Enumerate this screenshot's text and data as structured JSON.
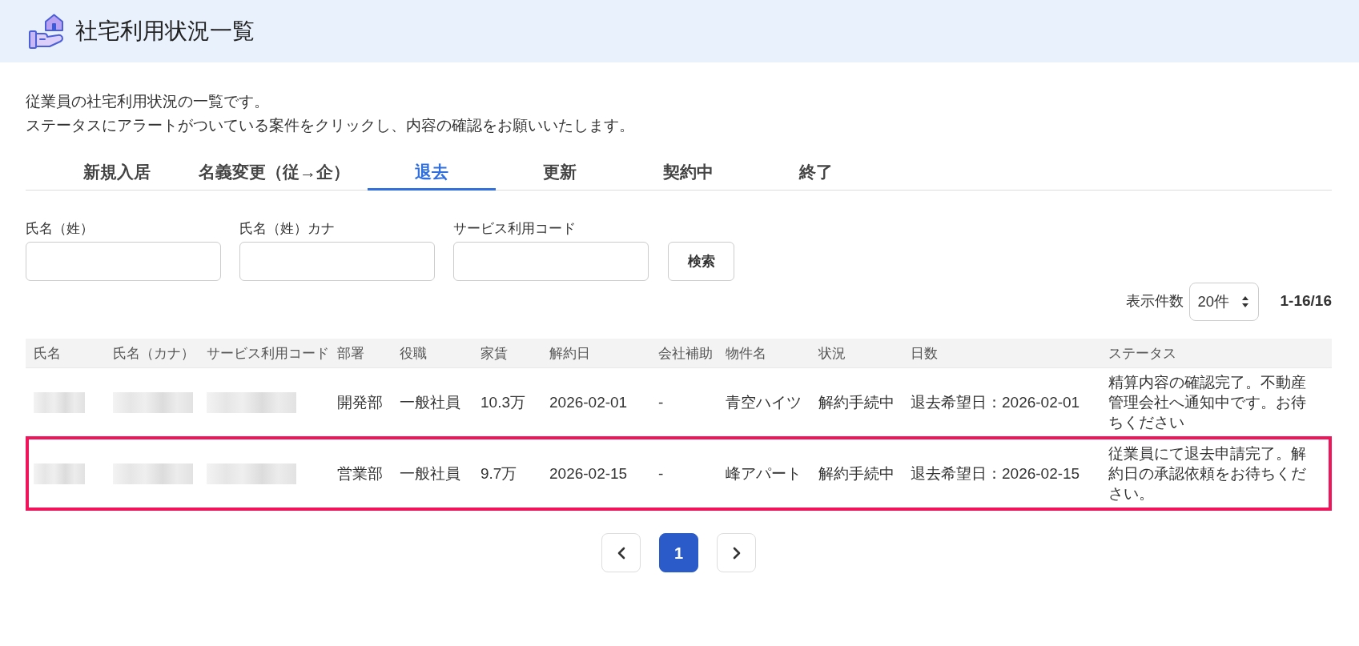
{
  "header": {
    "title": "社宅利用状況一覧"
  },
  "description": [
    "従業員の社宅利用状況の一覧です。",
    "ステータスにアラートがついている案件をクリックし、内容の確認をお願いいたします。"
  ],
  "tabs": [
    {
      "label": "新規入居",
      "selected": false
    },
    {
      "label": "名義変更（従→企）",
      "selected": false
    },
    {
      "label": "退去",
      "selected": true
    },
    {
      "label": "更新",
      "selected": false
    },
    {
      "label": "契約中",
      "selected": false
    },
    {
      "label": "終了",
      "selected": false
    }
  ],
  "search": {
    "fields": [
      {
        "label": "氏名（姓）"
      },
      {
        "label": "氏名（姓）カナ"
      },
      {
        "label": "サービス利用コード"
      }
    ],
    "button": "検索"
  },
  "page_size": {
    "label": "表示件数",
    "value": "20件"
  },
  "range": "1-16/16",
  "table": {
    "columns": [
      "氏名",
      "氏名（カナ）",
      "サービス利用コード",
      "部署",
      "役職",
      "家賃",
      "解約日",
      "会社補助",
      "物件名",
      "状況",
      "日数",
      "ステータス"
    ],
    "rows": [
      {
        "masked": true,
        "highlighted": false,
        "cells": [
          "",
          "",
          "",
          "開発部",
          "一般社員",
          "10.3万",
          "2026-02-01",
          "-",
          "青空ハイツ",
          "解約手続中",
          "退去希望日：2026-02-01",
          "精算内容の確認完了。不動産管理会社へ通知中です。お待ちください"
        ]
      },
      {
        "masked": true,
        "highlighted": true,
        "cells": [
          "",
          "",
          "",
          "営業部",
          "一般社員",
          "9.7万",
          "2026-02-15",
          "-",
          "峰アパート",
          "解約手続中",
          "退去希望日：2026-02-15",
          "従業員にて退去申請完了。解約日の承認依頼をお待ちください。"
        ]
      }
    ]
  },
  "pagination": {
    "pages": [
      {
        "label": "1",
        "selected": true
      }
    ]
  }
}
